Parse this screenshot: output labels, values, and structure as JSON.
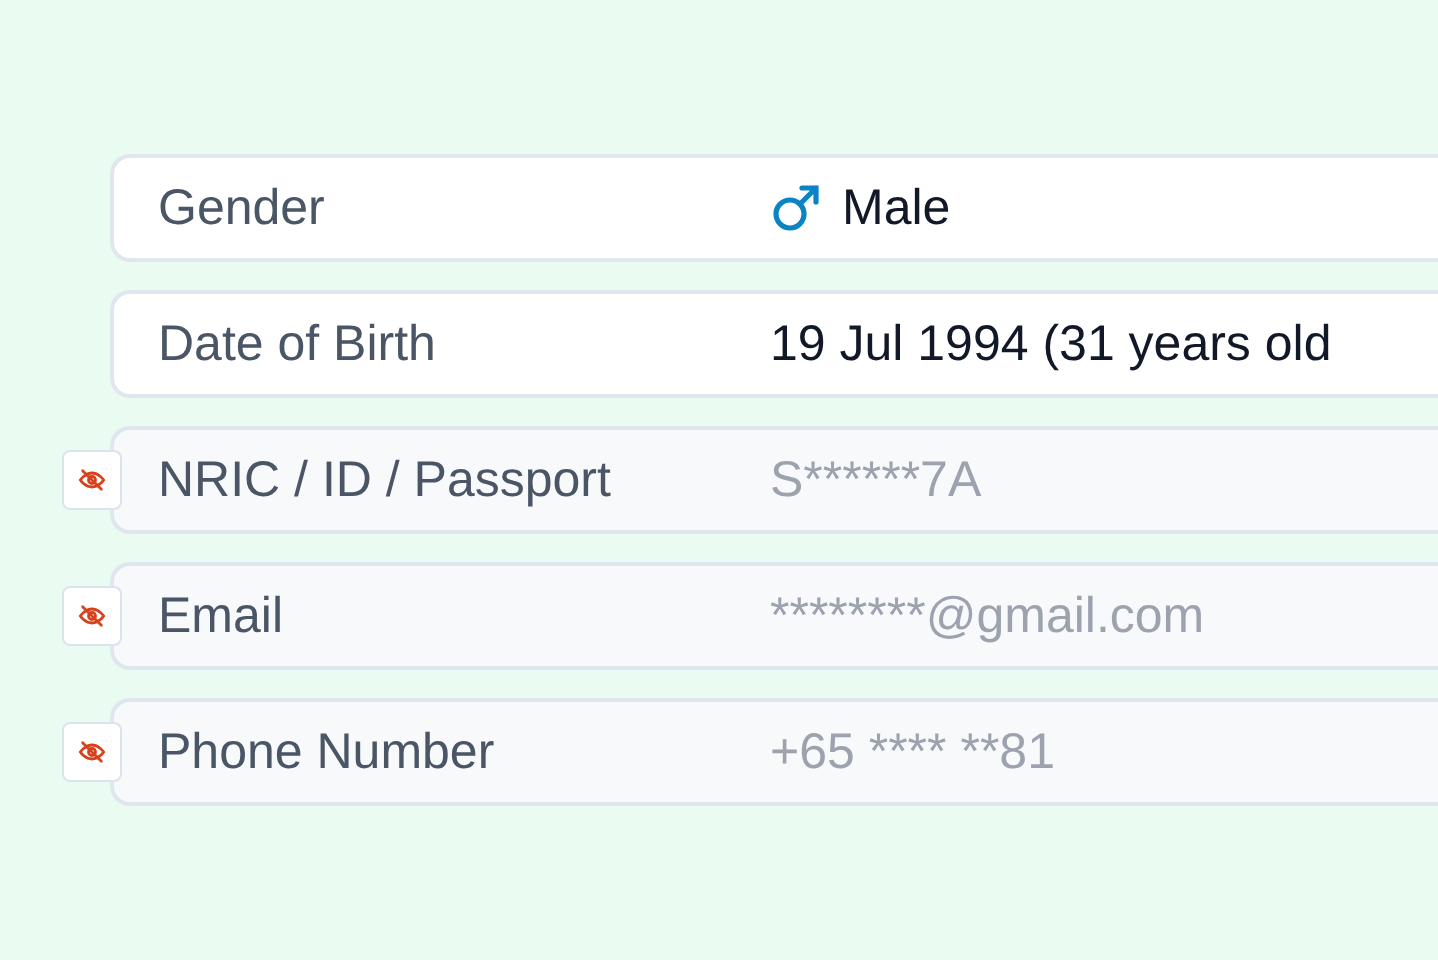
{
  "rows": [
    {
      "kind": "gender",
      "label": "Gender",
      "value": "Male",
      "masked": false
    },
    {
      "kind": "plain",
      "label": "Date of Birth",
      "value": "19 Jul 1994 (31 years old",
      "masked": false
    },
    {
      "kind": "plain",
      "label": "NRIC / ID / Passport",
      "value": "S******7A",
      "masked": true
    },
    {
      "kind": "plain",
      "label": "Email",
      "value": "********@gmail.com",
      "masked": true
    },
    {
      "kind": "plain",
      "label": "Phone Number",
      "value": "+65 **** **81",
      "masked": true
    }
  ]
}
